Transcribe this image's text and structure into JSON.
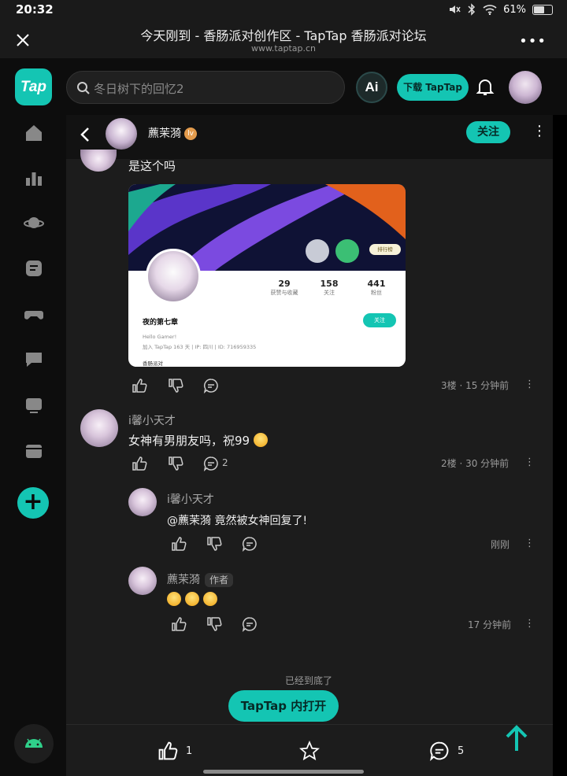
{
  "status_bar": {
    "time": "20:32",
    "battery": "61%",
    "battery_level": 0.61
  },
  "browser": {
    "title": "今天刚到 - 香肠派对创作区 - TapTap 香肠派对论坛",
    "url": "www.taptap.cn",
    "more": "•••"
  },
  "rail": {
    "logo": "Tap",
    "add": "+"
  },
  "header": {
    "search_placeholder": "冬日树下的回忆2",
    "ai_label": "Ai",
    "download_label": "下载 TapTap"
  },
  "post_bar": {
    "author_name": "藨茉漪",
    "badge": "lv",
    "follow_label": "关注",
    "more": "⋮"
  },
  "comments": {
    "floor3": {
      "text": "是这个吗",
      "meta": "3楼 · 15 分钟前"
    },
    "floor2": {
      "name": "i馨小天才",
      "text": "女神有男朋友吗，祝99",
      "reply_count": "2",
      "meta": "2楼 · 30 分钟前"
    },
    "reply1": {
      "name": "i馨小天才",
      "text": "@藨茉漪 竟然被女神回复了!",
      "meta": "刚刚"
    },
    "reply2": {
      "name": "藨茉漪",
      "author_tag": "作者",
      "meta": "17 分钟前"
    }
  },
  "embed": {
    "rank_label": "排行榜",
    "stats": [
      {
        "value": "29",
        "label": "获赞与收藏"
      },
      {
        "value": "158",
        "label": "关注"
      },
      {
        "value": "441",
        "label": "粉丝"
      }
    ],
    "profile_name": "夜的第七章",
    "follow_label": "关注",
    "bio": "Hello Gamer!",
    "joined": "加入 TapTap 163 天 | IP: 四川 | ID: 716959335",
    "game": "香肠派对"
  },
  "footer": {
    "end_text": "已经到底了",
    "open_label": "TapTap 内打开",
    "like_count": "1",
    "comment_count": "5"
  },
  "colors": {
    "accent": "#14c5b3",
    "panel": "#1c1c1c"
  }
}
